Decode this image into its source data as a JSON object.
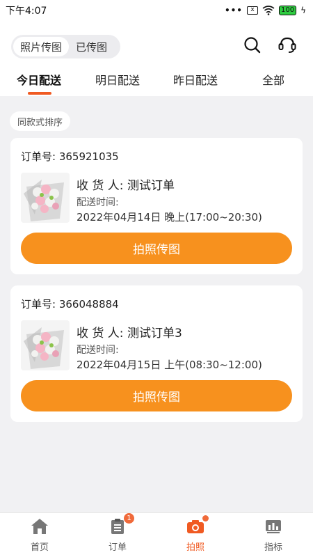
{
  "status_bar": {
    "time": "下午4:07",
    "dots": "•••",
    "sim": "x",
    "battery": "100",
    "charging": "ϟ"
  },
  "header": {
    "segments": [
      {
        "label": "照片传图",
        "active": true
      },
      {
        "label": "已传图",
        "active": false
      }
    ],
    "icons": [
      "search-icon",
      "customer-service-icon"
    ]
  },
  "tabs": [
    {
      "label": "今日配送",
      "active": true
    },
    {
      "label": "明日配送",
      "active": false
    },
    {
      "label": "昨日配送",
      "active": false
    },
    {
      "label": "全部",
      "active": false
    }
  ],
  "sort_chip": "同款式排序",
  "orders": [
    {
      "order_no": "订单号: 365921035",
      "receiver": "收 货 人: 测试订单",
      "time_label": "配送时间:",
      "time_value": "2022年04月14日 晚上(17:00~20:30)",
      "button": "拍照传图"
    },
    {
      "order_no": "订单号: 366048884",
      "receiver": "收 货 人: 测试订单3",
      "time_label": "配送时间:",
      "time_value": "2022年04月15日 上午(08:30~12:00)",
      "button": "拍照传图"
    }
  ],
  "bottom_nav": [
    {
      "label": "首页",
      "icon": "home-icon",
      "active": false
    },
    {
      "label": "订单",
      "icon": "order-clipboard-icon",
      "badge": "1",
      "active": false
    },
    {
      "label": "拍照",
      "icon": "camera-icon",
      "active": true
    },
    {
      "label": "指标",
      "icon": "chart-icon",
      "active": false
    }
  ],
  "colors": {
    "accent": "#f7911e",
    "tab_indicator": "#f05a22",
    "badge": "#f06a3a"
  }
}
